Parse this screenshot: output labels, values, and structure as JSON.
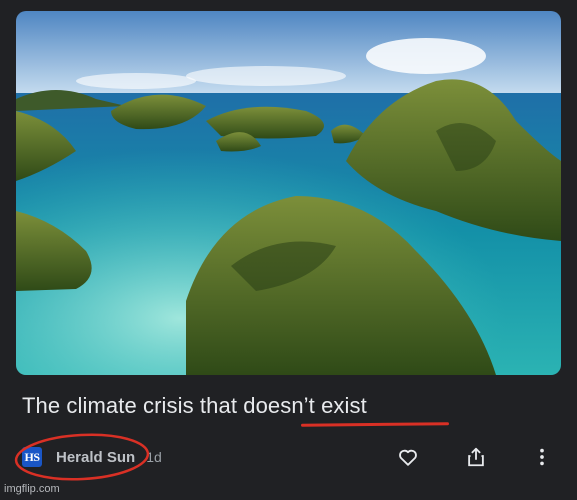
{
  "article": {
    "headline": "The climate crisis that doesn’t exist",
    "source_logo_text": "HS",
    "source_name": "Herald Sun",
    "age": "1d",
    "image_description_icon": "photo-tropical-islands"
  },
  "actions": {
    "like_icon": "heart-icon",
    "share_icon": "share-icon",
    "more_icon": "more-vert-icon"
  },
  "annotations": {
    "underline_color": "#d93025",
    "circle_color": "#d93025"
  },
  "watermark": "imgflip.com",
  "colors": {
    "background": "#202124",
    "headline": "#e8eaed",
    "source_logo_bg": "#1a56c6"
  }
}
